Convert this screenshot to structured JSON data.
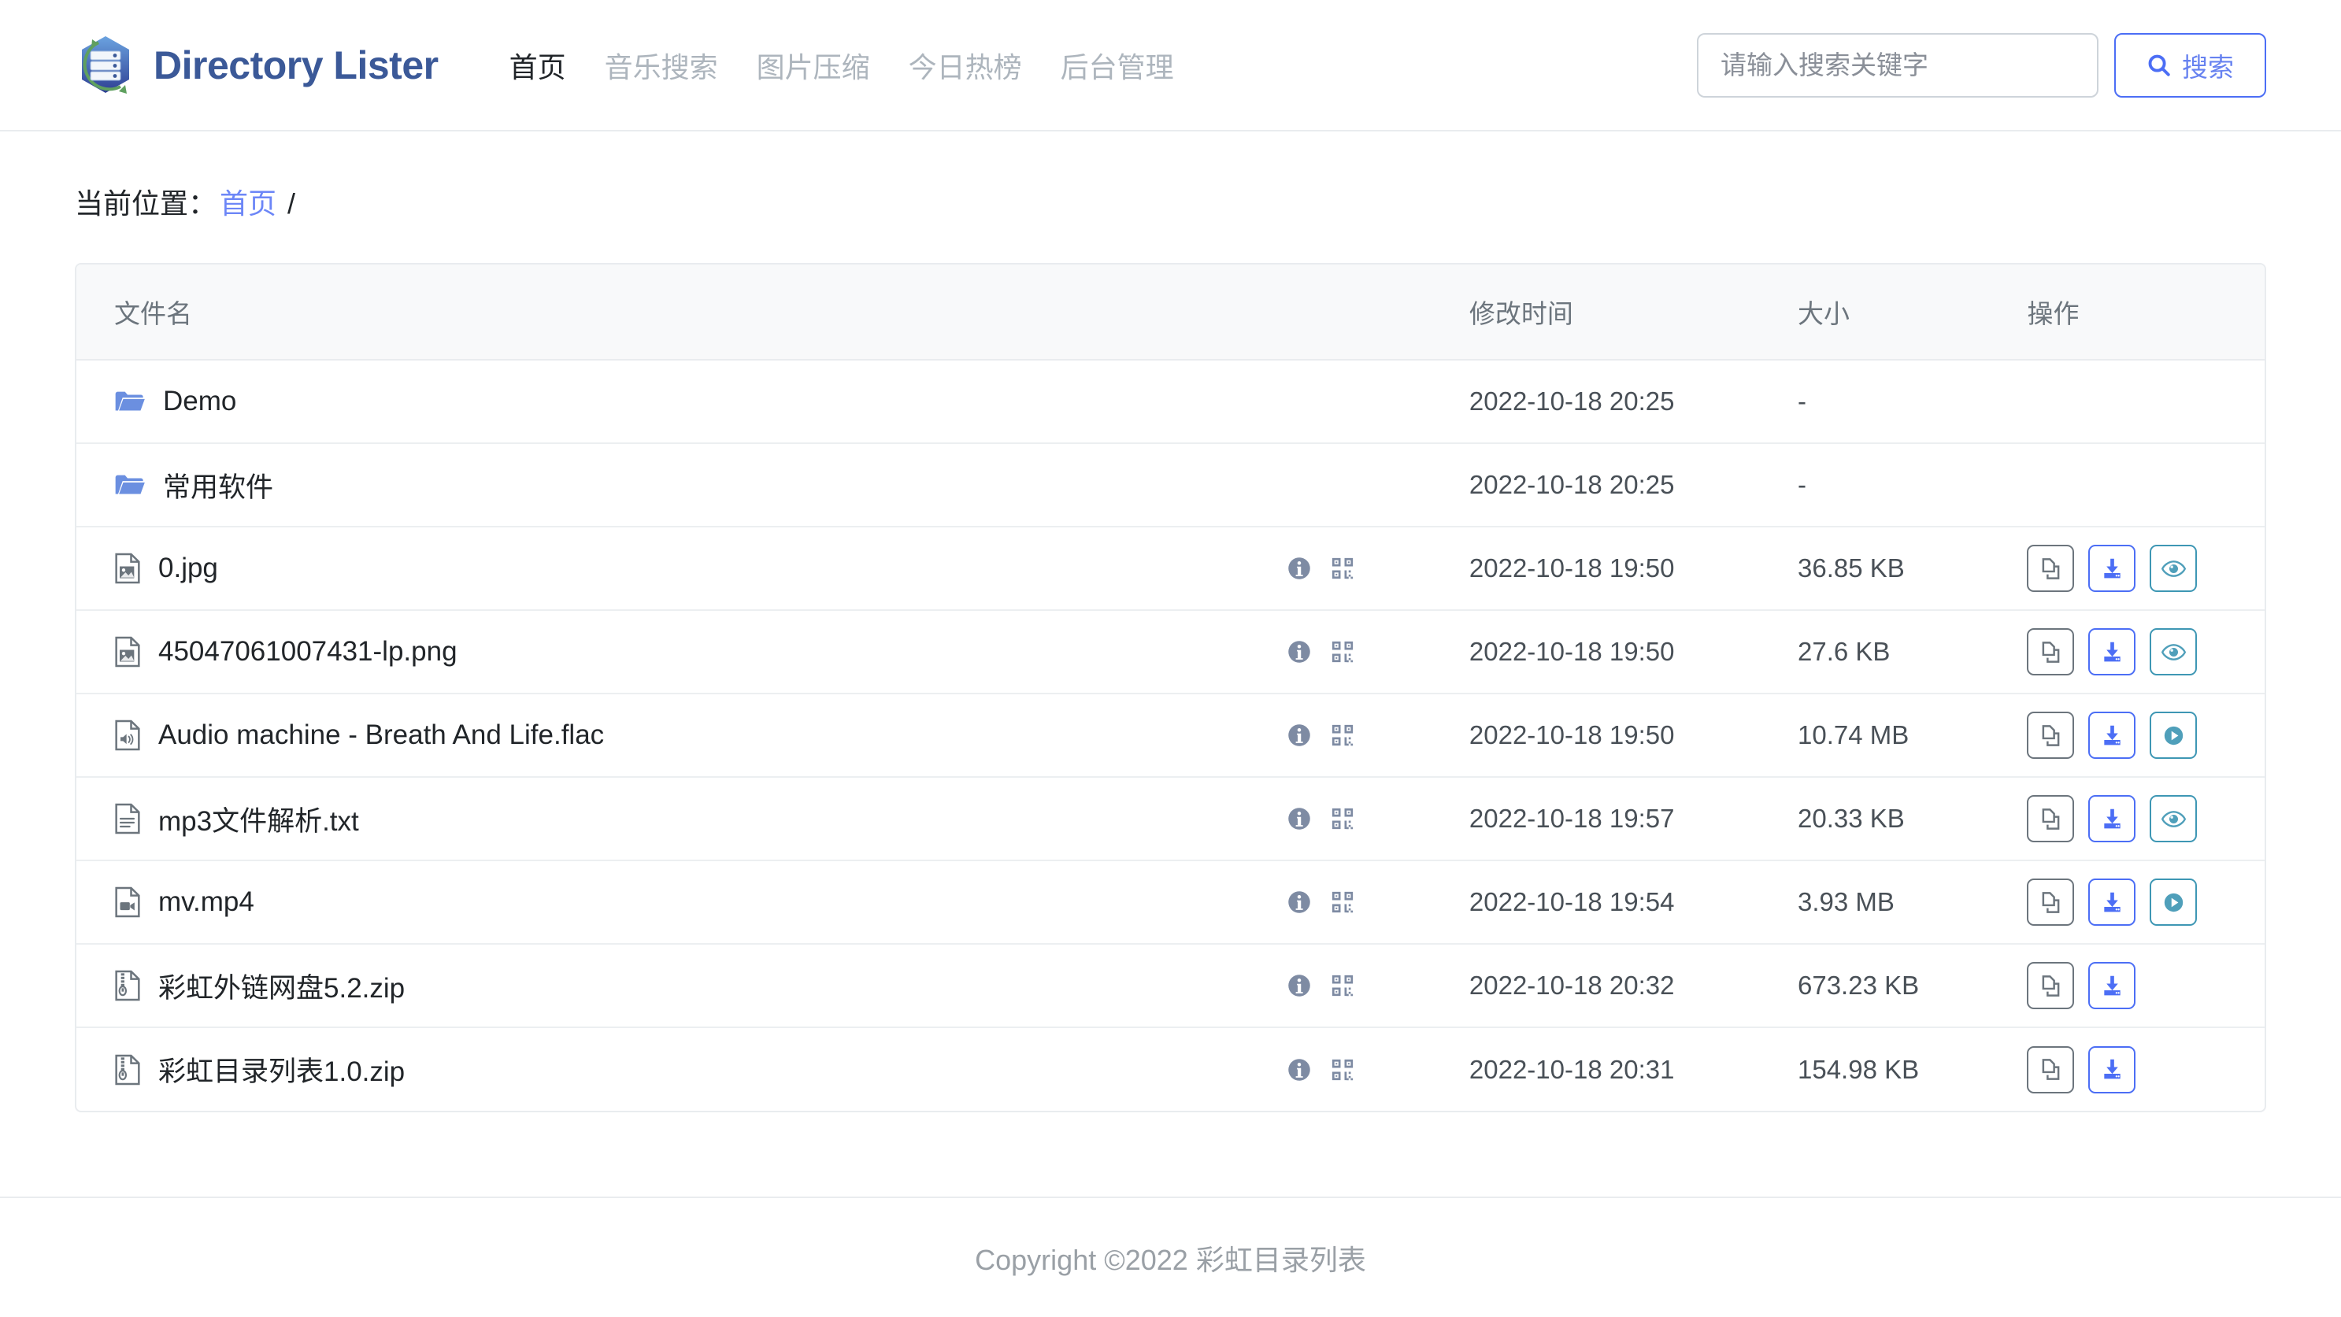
{
  "header": {
    "brand": "Directory Lister",
    "logo_icon": "directory-lister-logo",
    "nav": [
      {
        "label": "首页",
        "active": true
      },
      {
        "label": "音乐搜索",
        "active": false
      },
      {
        "label": "图片压缩",
        "active": false
      },
      {
        "label": "今日热榜",
        "active": false
      },
      {
        "label": "后台管理",
        "active": false
      }
    ],
    "search": {
      "placeholder": "请输入搜索关键字",
      "value": "",
      "button_label": "搜索",
      "button_icon": "search-icon"
    }
  },
  "breadcrumb": {
    "label": "当前位置：",
    "home": "首页",
    "separator": "/"
  },
  "table": {
    "columns": {
      "name": "文件名",
      "time": "修改时间",
      "size": "大小",
      "actions": "操作"
    },
    "rows": [
      {
        "name": "Demo",
        "type": "folder",
        "icon": "folder-icon",
        "time": "2022-10-18 20:25",
        "size": "-",
        "meta_icons": [],
        "actions": []
      },
      {
        "name": "常用软件",
        "type": "folder",
        "icon": "folder-icon",
        "time": "2022-10-18 20:25",
        "size": "-",
        "meta_icons": [],
        "actions": []
      },
      {
        "name": "0.jpg",
        "type": "image",
        "icon": "file-image-icon",
        "time": "2022-10-18 19:50",
        "size": "36.85 KB",
        "meta_icons": [
          "info-icon",
          "qrcode-icon"
        ],
        "actions": [
          "copy-icon",
          "download-icon",
          "eye-icon"
        ]
      },
      {
        "name": "45047061007431-lp.png",
        "type": "image",
        "icon": "file-image-icon",
        "time": "2022-10-18 19:50",
        "size": "27.6 KB",
        "meta_icons": [
          "info-icon",
          "qrcode-icon"
        ],
        "actions": [
          "copy-icon",
          "download-icon",
          "eye-icon"
        ]
      },
      {
        "name": "Audio machine - Breath And Life.flac",
        "type": "audio",
        "icon": "file-audio-icon",
        "time": "2022-10-18 19:50",
        "size": "10.74 MB",
        "meta_icons": [
          "info-icon",
          "qrcode-icon"
        ],
        "actions": [
          "copy-icon",
          "download-icon",
          "play-icon"
        ]
      },
      {
        "name": "mp3文件解析.txt",
        "type": "text",
        "icon": "file-text-icon",
        "time": "2022-10-18 19:57",
        "size": "20.33 KB",
        "meta_icons": [
          "info-icon",
          "qrcode-icon"
        ],
        "actions": [
          "copy-icon",
          "download-icon",
          "eye-icon"
        ]
      },
      {
        "name": "mv.mp4",
        "type": "video",
        "icon": "file-video-icon",
        "time": "2022-10-18 19:54",
        "size": "3.93 MB",
        "meta_icons": [
          "info-icon",
          "qrcode-icon"
        ],
        "actions": [
          "copy-icon",
          "download-icon",
          "play-icon"
        ]
      },
      {
        "name": "彩虹外链网盘5.2.zip",
        "type": "archive",
        "icon": "file-zip-icon",
        "time": "2022-10-18 20:32",
        "size": "673.23 KB",
        "meta_icons": [
          "info-icon",
          "qrcode-icon"
        ],
        "actions": [
          "copy-icon",
          "download-icon"
        ]
      },
      {
        "name": "彩虹目录列表1.0.zip",
        "type": "archive",
        "icon": "file-zip-icon",
        "time": "2022-10-18 20:31",
        "size": "154.98 KB",
        "meta_icons": [
          "info-icon",
          "qrcode-icon"
        ],
        "actions": [
          "copy-icon",
          "download-icon"
        ]
      }
    ]
  },
  "footer": {
    "text": "Copyright ©2022 彩虹目录列表"
  },
  "colors": {
    "brand": "#3b5998",
    "link": "#6c86f7",
    "accent_blue": "#4c6ef5",
    "accent_teal": "#3e97b4",
    "folder": "#6b8fe0",
    "muted": "#6c757d",
    "border": "#e9ecef",
    "header_bg": "#f8f9fa"
  }
}
